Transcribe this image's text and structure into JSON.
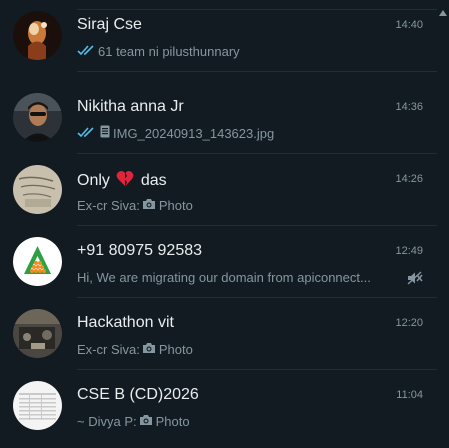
{
  "chats": [
    {
      "name": "Siraj Cse",
      "time": "14:40",
      "sender": "",
      "message": "61 team ni pilusthunnary",
      "read_ticks": true,
      "media_icon": "",
      "muted": false
    },
    {
      "name": "Nikitha anna Jr",
      "time": "14:36",
      "sender": "",
      "message": "IMG_20240913_143623.jpg",
      "read_ticks": true,
      "media_icon": "document-icon",
      "muted": false
    },
    {
      "name_before": "Only",
      "name_emoji": "broken-heart-icon",
      "name_after": "das",
      "time": "14:26",
      "sender": "Ex-cr Siva:",
      "message": "Photo",
      "read_ticks": false,
      "media_icon": "camera-icon",
      "muted": false
    },
    {
      "name": "+91 80975 92583",
      "time": "12:49",
      "sender": "",
      "message": "Hi, We are migrating our domain from apiconnect...",
      "read_ticks": false,
      "media_icon": "",
      "muted": true
    },
    {
      "name": "Hackathon vit",
      "time": "12:20",
      "sender": "Ex-cr Siva:",
      "message": "Photo",
      "read_ticks": false,
      "media_icon": "camera-icon",
      "muted": false
    },
    {
      "name": "CSE B (CD)2026",
      "time": "11:04",
      "sender": "~ Divya P:",
      "message": "Photo",
      "read_ticks": false,
      "media_icon": "camera-icon",
      "muted": false
    }
  ],
  "colors": {
    "background": "#111b21",
    "title_text": "#e9edef",
    "secondary_text": "#8696a0",
    "read_tick": "#53bdeb",
    "separator": "#222d34"
  }
}
